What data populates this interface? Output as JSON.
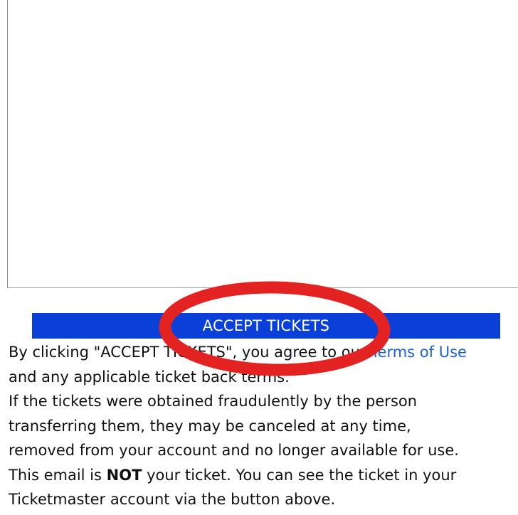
{
  "email": {
    "accept_button_label": "ACCEPT TICKETS",
    "terms": {
      "line1_prefix": "By clicking \"ACCEPT TICKETS\", you agree to our ",
      "link_text": "Terms of Use",
      "line2": "and any applicable ticket back terms.",
      "line3": "If the tickets were obtained fraudulently by the person",
      "line4": "transferring them, they may be canceled at any time,",
      "line5": "removed from your account and no longer available for use.",
      "line6_prefix": "This email is ",
      "line6_bold": "NOT",
      "line6_suffix": " your ticket. You can see the ticket in your",
      "line7": "Ticketmaster account via the button above."
    }
  },
  "colors": {
    "button_bg": "#0a3fd8",
    "link": "#1d5fd8",
    "annotation_ring": "#e32222"
  }
}
